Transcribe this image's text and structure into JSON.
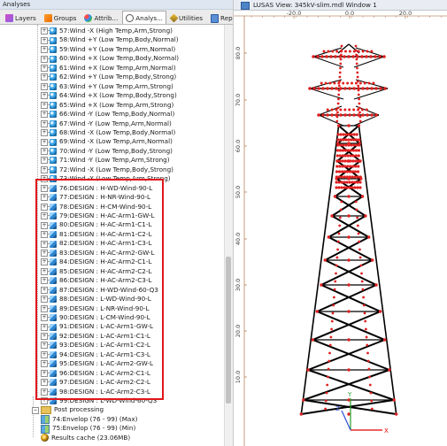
{
  "panel": {
    "title": "Analyses",
    "tabs": [
      {
        "label": "Layers",
        "icon": "layers-icon"
      },
      {
        "label": "Groups",
        "icon": "groups-icon"
      },
      {
        "label": "Attrib...",
        "icon": "attributes-icon"
      },
      {
        "label": "Analys...",
        "icon": "analyses-icon",
        "active": true
      },
      {
        "label": "Utilities",
        "icon": "utilities-icon"
      },
      {
        "label": "Reports",
        "icon": "reports-icon"
      }
    ]
  },
  "tree": {
    "load_cases": [
      "57:Wind -X (High Temp,Arm,Strong)",
      "58:Wind +Y (Low Temp,Body,Normal)",
      "59:Wind +Y (Low Temp,Arm,Normal)",
      "60:Wind +X (Low Temp,Body,Normal)",
      "61:Wind +X (Low Temp,Arm,Normal)",
      "62:Wind +Y (Low Temp,Body,Strong)",
      "63:Wind +Y (Low Temp,Arm,Strong)",
      "64:Wind +X (Low Temp,Body,Strong)",
      "65:Wind +X (Low Temp,Arm,Strong)",
      "66:Wind -Y (Low Temp,Body,Normal)",
      "67:Wind -Y (Low Temp,Arm,Normal)",
      "68:Wind -X (Low Temp,Body,Normal)",
      "69:Wind -X (Low Temp,Arm,Normal)",
      "70:Wind -Y (Low Temp,Body,Strong)",
      "71:Wind -Y (Low Temp,Arm,Strong)",
      "72:Wind -X (Low Temp,Body,Strong)",
      "73:Wind -X (Low Temp,Arm,Strong)"
    ],
    "design_cases": [
      "76:DESIGN : H-WD-Wind-90-L",
      "77:DESIGN : H-NR-Wind-90-L",
      "78:DESIGN : H-CM-Wind-90-L",
      "79:DESIGN : H-AC-Arm1-GW-L",
      "80:DESIGN : H-AC-Arm1-C1-L",
      "81:DESIGN : H-AC-Arm1-C2-L",
      "82:DESIGN : H-AC-Arm1-C3-L",
      "83:DESIGN : H-AC-Arm2-GW-L",
      "84:DESIGN : H-AC-Arm2-C1-L",
      "85:DESIGN : H-AC-Arm2-C2-L",
      "86:DESIGN : H-AC-Arm2-C3-L",
      "87:DESIGN : H-WD-Wind-60-Q3",
      "88:DESIGN : L-WD-Wind-90-L",
      "89:DESIGN : L-NR-Wind-90-L",
      "90:DESIGN : L-CM-Wind-90-L",
      "91:DESIGN : L-AC-Arm1-GW-L",
      "92:DESIGN : L-AC-Arm1-C1-L",
      "93:DESIGN : L-AC-Arm1-C2-L",
      "94:DESIGN : L-AC-Arm1-C3-L",
      "95:DESIGN : L-AC-Arm2-GW-L",
      "96:DESIGN : L-AC-Arm2-C1-L",
      "97:DESIGN : L-AC-Arm2-C2-L",
      "98:DESIGN : L-AC-Arm2-C3-L",
      "99:DESIGN : L-WD-Wind-60-Q3"
    ],
    "post_processing": {
      "label": "Post processing",
      "items": [
        "74:Envelop (76 - 99) (Max)",
        "75:Envelop (76 - 99) (Min)"
      ]
    },
    "results_cache": "Results cache (23.06MB)",
    "highlight_color": "#e1161b"
  },
  "view": {
    "title": "LUSAS View: 345kV-slim.mdl Window 1",
    "x_ticks": [
      "-20.0",
      "0.0",
      "20.0"
    ],
    "y_ticks": [
      "80.0",
      "70.0",
      "60.0",
      "50.0",
      "40.0",
      "30.0",
      "20.0",
      "10.0"
    ],
    "axes": {
      "x": "X",
      "y": "Y",
      "z": "Z"
    },
    "colors": {
      "member": "#000000",
      "node": "#e02020",
      "axis_x": "#e00000",
      "axis_y": "#2a9d2a",
      "axis_z": "#2b4fd6",
      "ruler": "#a05a2c"
    }
  }
}
